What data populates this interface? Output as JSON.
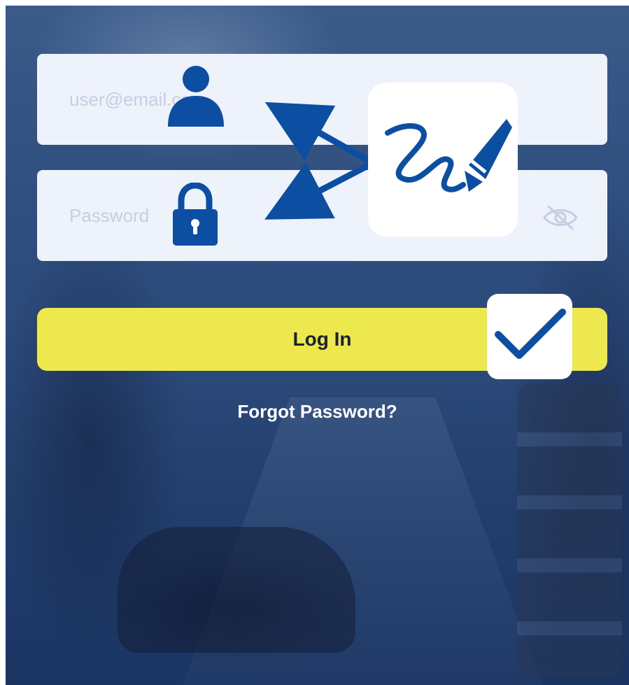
{
  "login_form": {
    "email_placeholder": "user@email.com",
    "password_placeholder": "Password",
    "login_label": "Log In",
    "forgot_label": "Forgot Password?"
  },
  "icons": {
    "user": "user-icon",
    "lock": "lock-icon",
    "signature": "signature-pen-icon",
    "check": "checkmark-icon",
    "eye": "eye-slash-icon"
  },
  "colors": {
    "overlay_blue": "#0b4ea2",
    "button_yellow": "#ece84e",
    "field_bg": "#eef2fb"
  }
}
